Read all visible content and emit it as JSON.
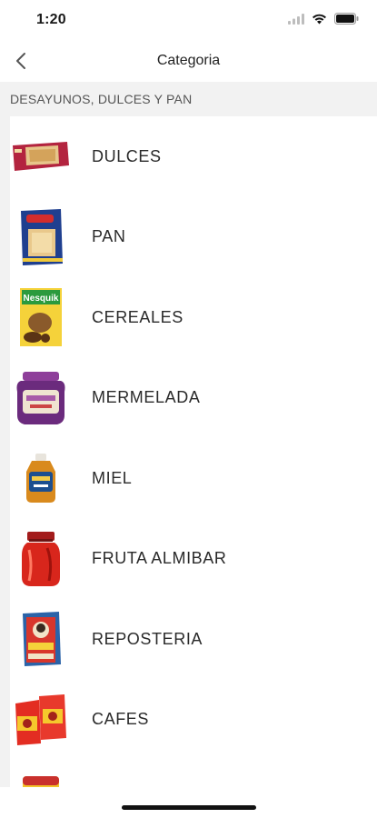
{
  "status_bar": {
    "time": "1:20",
    "icons": [
      "signal-icon",
      "wifi-icon",
      "battery-icon"
    ]
  },
  "nav": {
    "title": "Categoria",
    "back_icon": "chevron-left-icon"
  },
  "section": {
    "header": "DESAYUNOS, DULCES Y PAN"
  },
  "categories": [
    {
      "label": "DULCES",
      "icon": "biscuit-pack-icon"
    },
    {
      "label": "PAN",
      "icon": "bread-box-icon"
    },
    {
      "label": "CEREALES",
      "icon": "cereal-box-icon"
    },
    {
      "label": "MERMELADA",
      "icon": "jam-jar-icon"
    },
    {
      "label": "MIEL",
      "icon": "honey-jar-icon"
    },
    {
      "label": "FRUTA ALMIBAR",
      "icon": "fruit-jar-icon"
    },
    {
      "label": "REPOSTERIA",
      "icon": "baking-box-icon"
    },
    {
      "label": "CAFES",
      "icon": "coffee-pack-icon"
    },
    {
      "label": "",
      "icon": "product-can-icon"
    }
  ],
  "colors": {
    "section_bg": "#f2f2f2",
    "text": "#2a2a2a"
  }
}
